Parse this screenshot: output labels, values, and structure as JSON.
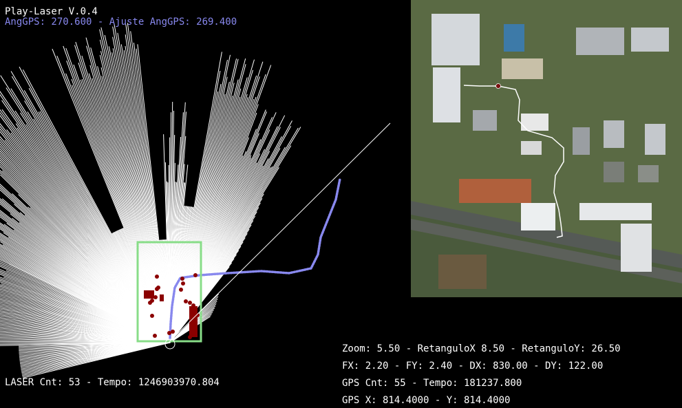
{
  "app": {
    "title": "Play-Laser V.0.4"
  },
  "gps_angle": {
    "line": "AngGPS: 270.600 - Ajuste AngGPS: 269.400"
  },
  "laser": {
    "status": "LASER Cnt: 53 - Tempo: 1246903970.804"
  },
  "info": {
    "zoom_line": "Zoom: 5.50 - RetanguloX 8.50 - RetanguloY: 26.50",
    "factor_line": "FX: 2.20 - FY: 2.40 - DX: 830.00 - DY: 122.00",
    "gps_count_line": "GPS Cnt: 55 - Tempo: 181237.800",
    "gps_pos_line": "GPS X: 814.4000 - Y: 814.4000"
  },
  "colors": {
    "background": "#000000",
    "laser_beams": "#ffffff",
    "gps_path": "#8888ee",
    "vehicle_rect": "#88dd88",
    "obstacle_points": "#8b0000",
    "map_path": "#ffffff"
  }
}
